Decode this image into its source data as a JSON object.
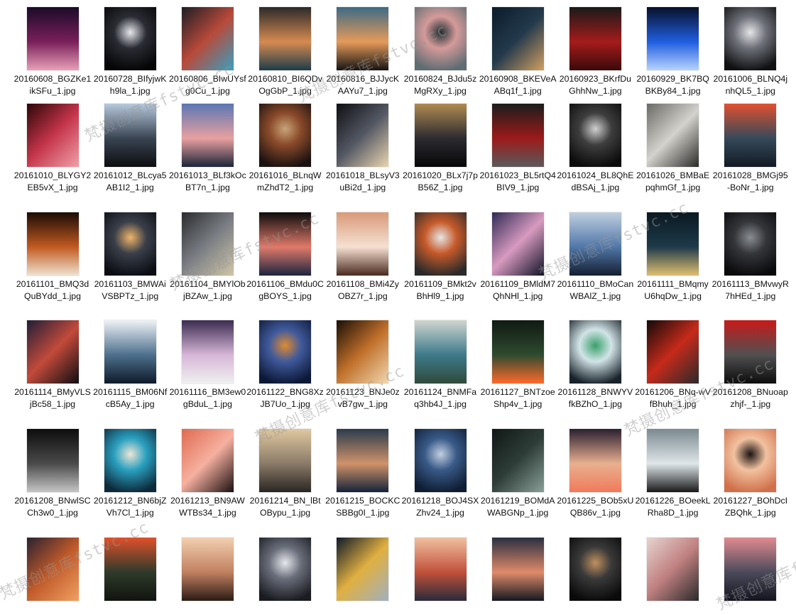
{
  "files": [
    {
      "label": "20160608_BGZKe1ikSFu_1.jpg",
      "colors": [
        "#1a0b2a",
        "#7a1f5a",
        "#e8a0b8"
      ]
    },
    {
      "label": "20160728_BIfyjwKh9la_1.jpg",
      "colors": [
        "#050506",
        "#2a2c33",
        "#e6e8ee"
      ]
    },
    {
      "label": "20160806_BIwUYsfg0Cu_1.jpg",
      "colors": [
        "#1c1d26",
        "#b84a3a",
        "#3aa0c0"
      ]
    },
    {
      "label": "20160810_BI6QDvOgGbP_1.jpg",
      "colors": [
        "#1d3b4a",
        "#d78a50",
        "#2a2a2a"
      ]
    },
    {
      "label": "20160816_BJJycKAAYu7_1.jpg",
      "colors": [
        "#3d6a86",
        "#e69a5a",
        "#141414"
      ]
    },
    {
      "label": "20160824_BJdu5zMgRXy_1.jpg",
      "colors": [
        "#5e6d72",
        "#d59a9a",
        "#213033"
      ]
    },
    {
      "label": "20160908_BKEVeAABq1f_1.jpg",
      "colors": [
        "#0b1b2a",
        "#233a4c",
        "#d0a060"
      ]
    },
    {
      "label": "20160923_BKrfDuGhhNw_1.jpg",
      "colors": [
        "#3a0a0a",
        "#a51b1b",
        "#1a1a1a"
      ]
    },
    {
      "label": "20160929_BK7BQBKBy84_1.jpg",
      "colors": [
        "#08102a",
        "#1f5ee0",
        "#b7d4ff"
      ]
    },
    {
      "label": "20161006_BLNQ4jnhQL5_1.jpg",
      "colors": [
        "#101012",
        "#6d7078",
        "#e5e5e8"
      ]
    },
    {
      "label": "20161010_BLYGY2EB5vX_1.jpg",
      "colors": [
        "#2a0707",
        "#c4344a",
        "#f0a0a8"
      ]
    },
    {
      "label": "20161012_BLcya5AB1I2_1.jpg",
      "colors": [
        "#0d0d10",
        "#394452",
        "#b6c8dc"
      ]
    },
    {
      "label": "20161013_BLf3kOcBT7n_1.jpg",
      "colors": [
        "#5b76b3",
        "#e8a0a0",
        "#1c2538"
      ]
    },
    {
      "label": "20161016_BLnqWmZhdT2_1.jpg",
      "colors": [
        "#1a1210",
        "#8a4a2a",
        "#c7a47a"
      ]
    },
    {
      "label": "20161018_BLsyV3uBi2d_1.jpg",
      "colors": [
        "#0f0f12",
        "#545864",
        "#e9d5b0"
      ]
    },
    {
      "label": "20161020_BLx7j7pB56Z_1.jpg",
      "colors": [
        "#070709",
        "#2b2b30",
        "#b08a50"
      ]
    },
    {
      "label": "20161023_BL5rtQ4BIV9_1.jpg",
      "colors": [
        "#1c1c1c",
        "#9d1a1a",
        "#5a5a5a"
      ]
    },
    {
      "label": "20161024_BL8QhEdBSAj_1.jpg",
      "colors": [
        "#0b0b0b",
        "#3e3e3e",
        "#d0d0d0"
      ]
    },
    {
      "label": "20161026_BMBaEpqhmGf_1.jpg",
      "colors": [
        "#6a6a66",
        "#d4d2cc",
        "#2a2a28"
      ]
    },
    {
      "label": "20161028_BMGj95-BoNr_1.jpg",
      "colors": [
        "#101a24",
        "#36495a",
        "#e05030"
      ]
    },
    {
      "label": "20161101_BMQ3dQuBYdd_1.jpg",
      "colors": [
        "#1b0a05",
        "#c25a20",
        "#efe2d0"
      ]
    },
    {
      "label": "20161103_BMWAiVSBPTz_1.jpg",
      "colors": [
        "#0c0e14",
        "#3a3f4a",
        "#f0b56a"
      ]
    },
    {
      "label": "20161104_BMYlObjBZAw_1.jpg",
      "colors": [
        "#2a2c2e",
        "#7b7e84",
        "#d0c6a8"
      ]
    },
    {
      "label": "20161106_BMdu0CgBOYS_1.jpg",
      "colors": [
        "#1c2440",
        "#e07a6a",
        "#0c0c0c"
      ]
    },
    {
      "label": "20161108_BMi4ZyOBZ7r_1.jpg",
      "colors": [
        "#d89a78",
        "#f6e0d2",
        "#4a2a1f"
      ]
    },
    {
      "label": "20161109_BMkt2vBhHl9_1.jpg",
      "colors": [
        "#2a2a2a",
        "#c65a2a",
        "#e6e6e6"
      ]
    },
    {
      "label": "20161109_BMldM7QhNHl_1.jpg",
      "colors": [
        "#2e2b55",
        "#d89ac0",
        "#0f1226"
      ]
    },
    {
      "label": "20161110_BMoCanWBAlZ_1.jpg",
      "colors": [
        "#141e30",
        "#5077a8",
        "#c0cfe0"
      ]
    },
    {
      "label": "20161111_BMqmyU6hqDw_1.jpg",
      "colors": [
        "#0a1820",
        "#1e3a4a",
        "#e0c070"
      ]
    },
    {
      "label": "20161113_BMvwyR7hHEd_1.jpg",
      "colors": [
        "#0a0a0c",
        "#34363a",
        "#8a8d92"
      ]
    },
    {
      "label": "20161114_BMyVLSjBc58_1.jpg",
      "colors": [
        "#201e38",
        "#c24a3a",
        "#0d0d10"
      ]
    },
    {
      "label": "20161115_BM06NfcB5Ay_1.jpg",
      "colors": [
        "#0d1a2a",
        "#4d6f8c",
        "#eef2f6"
      ]
    },
    {
      "label": "20161116_BM3ew0gBduL_1.jpg",
      "colors": [
        "#3a2c50",
        "#d7b6d8",
        "#f0f0f0"
      ]
    },
    {
      "label": "20161122_BNG8XzJB7Uo_1.jpg",
      "colors": [
        "#0c1836",
        "#405a9c",
        "#e08a30"
      ]
    },
    {
      "label": "20161123_BNJe0zvB7gw_1.jpg",
      "colors": [
        "#1a0f06",
        "#c0702a",
        "#f2d7b0"
      ]
    },
    {
      "label": "20161124_BNMFaq3hb4J_1.jpg",
      "colors": [
        "#2f4a3a",
        "#3d7a8a",
        "#cfd6d0"
      ]
    },
    {
      "label": "20161127_BNTzoeShp4v_1.jpg",
      "colors": [
        "#0f1a12",
        "#2f4a30",
        "#ff6a2a"
      ]
    },
    {
      "label": "20161128_BNWYVfkBZhO_1.jpg",
      "colors": [
        "#18222a",
        "#d2e4e8",
        "#3aa06a"
      ]
    },
    {
      "label": "20161206_BNq-wVfBhuh_1.jpg",
      "colors": [
        "#120a0a",
        "#c62a1a",
        "#2a2a2a"
      ]
    },
    {
      "label": "20161208_BNuoapzhjf-_1.jpg",
      "colors": [
        "#0c0c0c",
        "#505050",
        "#c81a1a"
      ]
    },
    {
      "label": "20161208_BNwlSCCh3w0_1.jpg",
      "colors": [
        "#0d0d0d",
        "#4a4a4a",
        "#c6c6c6"
      ]
    },
    {
      "label": "20161212_BN6bjZVh7Cl_1.jpg",
      "colors": [
        "#0d2a3a",
        "#2aa0c0",
        "#efe6d6"
      ]
    },
    {
      "label": "20161213_BN9AWWTBs34_1.jpg",
      "colors": [
        "#e06a50",
        "#f6b0a0",
        "#1a0f0f"
      ]
    },
    {
      "label": "20161214_BN_lBtOBypu_1.jpg",
      "colors": [
        "#2a2622",
        "#8a7a68",
        "#e0c8a0"
      ]
    },
    {
      "label": "20161215_BOCKCSBBg0I_1.jpg",
      "colors": [
        "#2a3c4c",
        "#d0926a",
        "#14233a"
      ]
    },
    {
      "label": "20161218_BOJ4SXZhv24_1.jpg",
      "colors": [
        "#0f1d33",
        "#395a88",
        "#c2cfe0"
      ]
    },
    {
      "label": "20161219_BOMdAWABGNp_1.jpg",
      "colors": [
        "#0f1816",
        "#2e3d38",
        "#8aa098"
      ]
    },
    {
      "label": "20161225_BOb5xUQB86v_1.jpg",
      "colors": [
        "#f07a5a",
        "#e8b090",
        "#2a2030"
      ]
    },
    {
      "label": "20161226_BOeekLRha8D_1.jpg",
      "colors": [
        "#7b8a90",
        "#dfe6ea",
        "#1a1a1a"
      ]
    },
    {
      "label": "20161227_BOhDcIZBQhk_1.jpg",
      "colors": [
        "#d0704a",
        "#f2c2a0",
        "#1a1412"
      ]
    },
    {
      "label": "",
      "colors": [
        "#2a2230",
        "#c05a2a",
        "#f0a060"
      ]
    },
    {
      "label": "",
      "colors": [
        "#10140f",
        "#2e3a2a",
        "#e0502a"
      ]
    },
    {
      "label": "",
      "colors": [
        "#f2d0b0",
        "#c08060",
        "#2a1c14"
      ]
    },
    {
      "label": "",
      "colors": [
        "#1a1c22",
        "#6a6e7a",
        "#e6e8ee"
      ]
    },
    {
      "label": "",
      "colors": [
        "#0e1a2a",
        "#e0b040",
        "#a0b0c0"
      ]
    },
    {
      "label": "",
      "colors": [
        "#2a2a3a",
        "#c0503a",
        "#f0c0a0"
      ]
    },
    {
      "label": "",
      "colors": [
        "#2a2f40",
        "#e08a6a",
        "#141820"
      ]
    },
    {
      "label": "",
      "colors": [
        "#0a0a0a",
        "#3a3a3a",
        "#c09060"
      ]
    },
    {
      "label": "",
      "colors": [
        "#e6d4d0",
        "#c08080",
        "#2a2a2a"
      ]
    },
    {
      "label": "",
      "colors": [
        "#141420",
        "#4a4a5a",
        "#e08a90"
      ]
    }
  ],
  "watermarks": [
    {
      "text": "梵摄创意库fstvc.cc"
    },
    {
      "text": "梵摄创意库fstvc.cc"
    },
    {
      "text": "梵摄创意库fstvc.cc"
    },
    {
      "text": "梵摄创意库fstvc.cc"
    },
    {
      "text": "梵摄创意库fstvc.cc"
    },
    {
      "text": "梵摄创意库fstvc.cc"
    },
    {
      "text": "梵摄创意库fstvc.cc"
    },
    {
      "text": "梵摄创意库fstvc.cc"
    }
  ]
}
